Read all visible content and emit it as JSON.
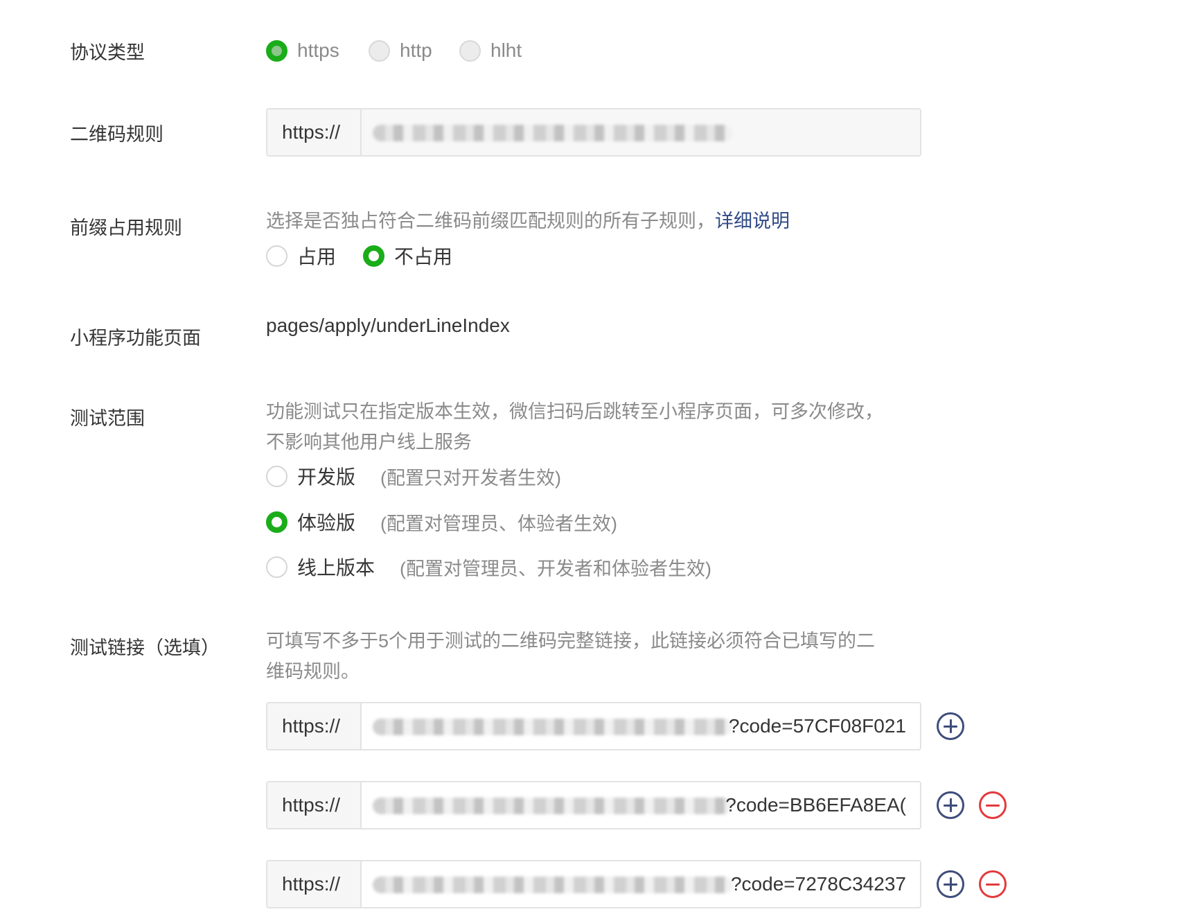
{
  "protocol": {
    "label": "协议类型",
    "options": [
      {
        "text": "https",
        "state": "checked"
      },
      {
        "text": "http",
        "state": "unchecked"
      },
      {
        "text": "hlht",
        "state": "unchecked"
      }
    ]
  },
  "qr_rule": {
    "label": "二维码规则",
    "prefix": "https://",
    "value": ""
  },
  "prefix_rule": {
    "label": "前缀占用规则",
    "description": "选择是否独占符合二维码前缀匹配规则的所有子规则，",
    "link_text": "详细说明",
    "options": [
      {
        "text": "占用",
        "state": "unchecked"
      },
      {
        "text": "不占用",
        "state": "checked"
      }
    ]
  },
  "mini_page": {
    "label": "小程序功能页面",
    "value": "pages/apply/underLineIndex"
  },
  "test_scope": {
    "label": "测试范围",
    "description_line1": "功能测试只在指定版本生效，微信扫码后跳转至小程序页面，可多次修改，",
    "description_line2": "不影响其他用户线上服务",
    "options": [
      {
        "text": "开发版",
        "hint": "(配置只对开发者生效)",
        "state": "unchecked"
      },
      {
        "text": "体验版",
        "hint": "(配置对管理员、体验者生效)",
        "state": "checked"
      },
      {
        "text": "线上版本",
        "hint": "(配置对管理员、开发者和体验者生效)",
        "state": "unchecked"
      }
    ]
  },
  "test_links": {
    "label": "测试链接（选填）",
    "description_line1": "可填写不多于5个用于测试的二维码完整链接，此链接必须符合已填写的二",
    "description_line2": "维码规则。",
    "links": [
      {
        "prefix": "https://",
        "value_suffix": "?code=57CF08F021"
      },
      {
        "prefix": "https://",
        "value_suffix": "?code=BB6EFA8EA("
      },
      {
        "prefix": "https://",
        "value_suffix": "?code=7278C34237"
      }
    ]
  },
  "colors": {
    "accent_green": "#1aad19",
    "link_blue": "#304a87",
    "remove_red": "#e4393c",
    "add_navy": "#3e4d7a"
  }
}
